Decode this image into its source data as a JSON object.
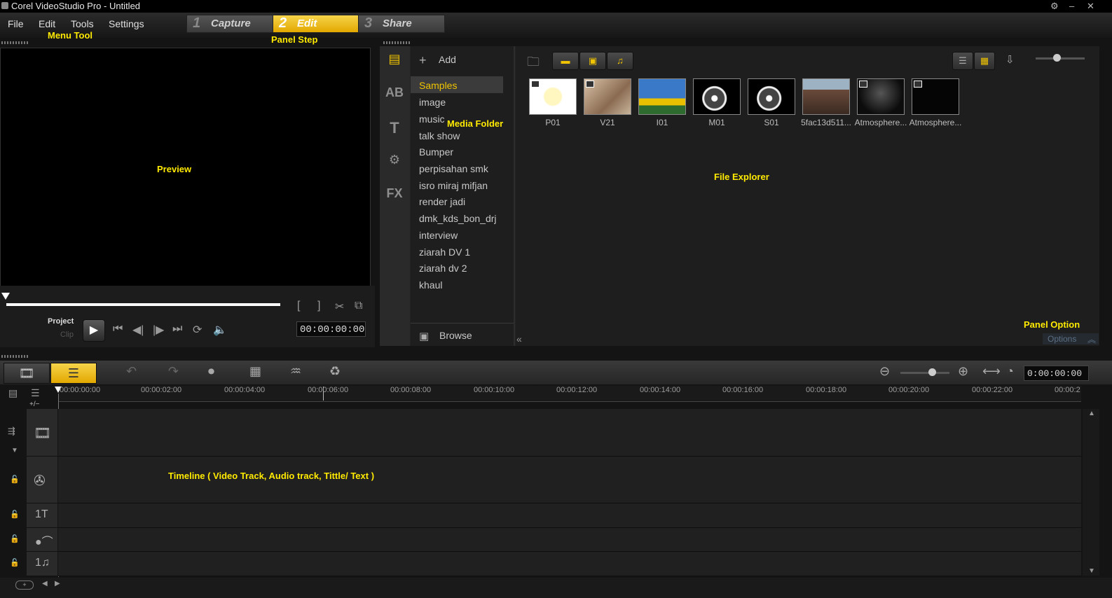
{
  "window": {
    "title": "Corel VideoStudio Pro - Untitled",
    "controls": [
      "⚙",
      "–",
      "✕"
    ]
  },
  "menu": {
    "items": [
      "File",
      "Edit",
      "Tools",
      "Settings"
    ]
  },
  "steps": [
    {
      "num": "1",
      "label": "Capture"
    },
    {
      "num": "2",
      "label": "Edit"
    },
    {
      "num": "3",
      "label": "Share"
    }
  ],
  "annotations": {
    "menu_tool": "Menu Tool",
    "panel_step": "Panel Step",
    "preview": "Preview",
    "media_folder": "Media Folder",
    "file_explorer": "File Explorer",
    "panel_option": "Panel Option",
    "timeline": "Timeline ( Video Track, Audio track, Tittle/ Text )"
  },
  "player": {
    "mode_project": "Project",
    "mode_clip": "Clip",
    "timecode": "00:00:00:00"
  },
  "library": {
    "add_label": "Add",
    "browse_label": "Browse",
    "folders": [
      "Samples",
      "image",
      "music",
      "talk show",
      "Bumper",
      "perpisahan smk",
      "isro miraj mifjan",
      "render jadi",
      "dmk_kds_bon_drj",
      "interview",
      "ziarah DV 1",
      "ziarah dv 2",
      "khaul"
    ],
    "selected_folder": "Samples",
    "options_label": "Options",
    "thumbnails": [
      "P01",
      "V21",
      "I01",
      "M01",
      "S01",
      "5fac13d511...",
      "Atmosphere...",
      "Atmosphere..."
    ]
  },
  "timeline": {
    "timecode": "0:00:00:00",
    "ruler": [
      "00:00:00:00",
      "00:00:02:00",
      "00:00:04:00",
      "00:00:06:00",
      "00:00:08:00",
      "00:00:10:00",
      "00:00:12:00",
      "00:00:14:00",
      "00:00:16:00",
      "00:00:18:00",
      "00:00:20:00",
      "00:00:22:00",
      "00:00:2"
    ],
    "zoom_label": "+/−"
  },
  "colors": {
    "accent": "#f0c400",
    "annotation": "#ffea00",
    "background": "#141414"
  }
}
